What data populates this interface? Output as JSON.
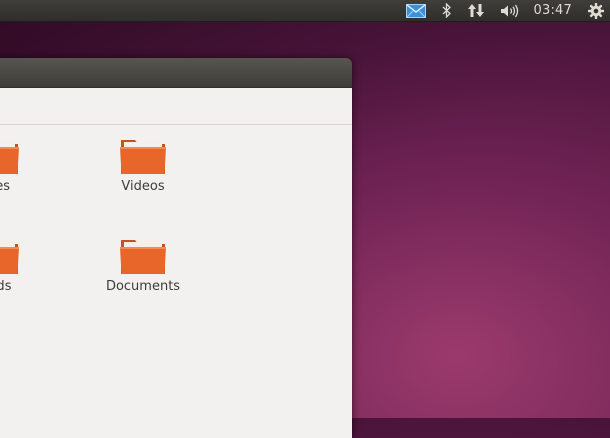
{
  "panel": {
    "indicators": [
      {
        "icon": "mail-icon",
        "color": "#3d8fd8"
      },
      {
        "icon": "bluetooth-icon"
      },
      {
        "icon": "network-icon"
      },
      {
        "icon": "volume-icon"
      }
    ],
    "clock": "03:47",
    "session_icon": "gear-icon"
  },
  "window": {
    "items": [
      {
        "label": "ures",
        "icon": "folder-icon"
      },
      {
        "label": "Videos",
        "icon": "folder-icon"
      },
      {
        "label": "oads",
        "icon": "folder-icon"
      },
      {
        "label": "Documents",
        "icon": "folder-icon"
      }
    ]
  },
  "colors": {
    "folder_orange": "#e8662a",
    "wallpaper": "#5a1a48",
    "panel": "#3a3935"
  }
}
